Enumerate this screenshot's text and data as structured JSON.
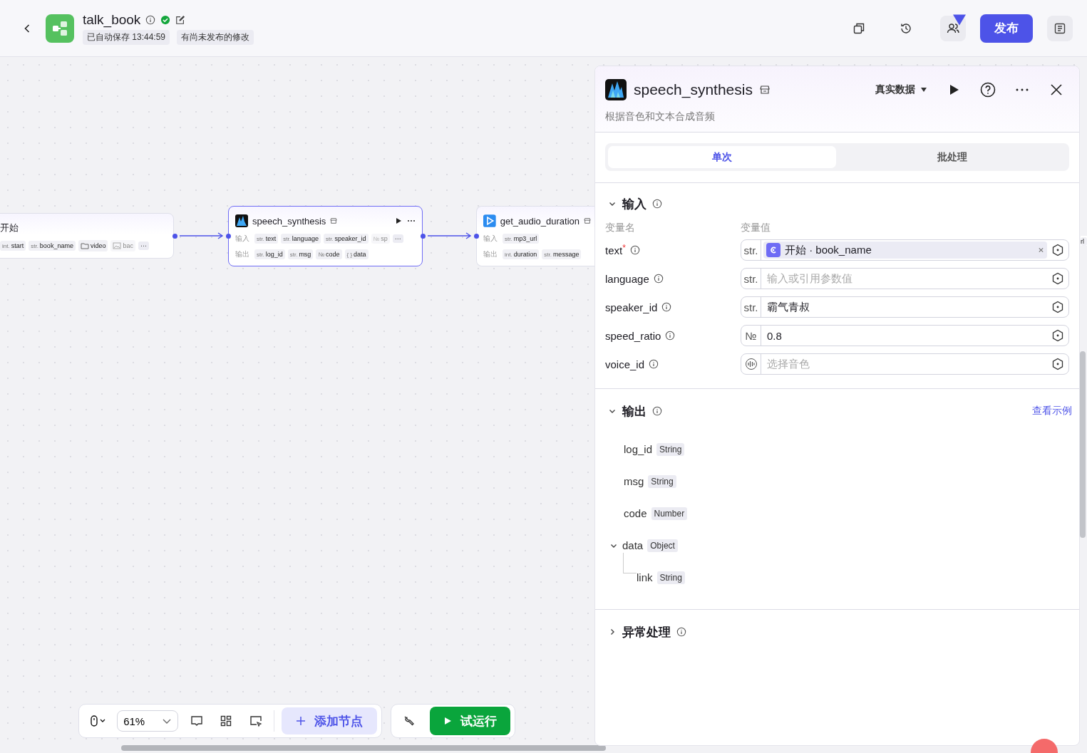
{
  "header": {
    "title": "talk_book",
    "verified": true,
    "autosave": "已自动保存 13:44:59",
    "unpublished": "有尚未发布的修改",
    "collaborators_badge": true,
    "publish": "发布"
  },
  "canvas": {
    "nodes": [
      {
        "kind": "start",
        "title": "开始",
        "selected": false,
        "rows": [
          {
            "tags": [
              {
                "kind": "typed",
                "type": "int.",
                "name": "start",
                "faded": false
              },
              {
                "kind": "typed",
                "type": "str.",
                "name": "book_name",
                "faded": false
              },
              {
                "kind": "folder",
                "name": "video",
                "faded": false
              },
              {
                "kind": "image",
                "name": "bac",
                "faded": true
              }
            ],
            "more": "⋯"
          }
        ]
      },
      {
        "kind": "plugin",
        "title": "speech_synthesis",
        "selected": true,
        "rows": [
          {
            "label": "输入",
            "tags": [
              {
                "kind": "typed",
                "type": "str.",
                "name": "text",
                "faded": false
              },
              {
                "kind": "typed",
                "type": "str.",
                "name": "language",
                "faded": false
              },
              {
                "kind": "typed",
                "type": "str.",
                "name": "speaker_id",
                "faded": false
              },
              {
                "kind": "typed",
                "type": "№",
                "name": "sp",
                "faded": true
              }
            ],
            "more": "⋯"
          },
          {
            "label": "输出",
            "tags": [
              {
                "kind": "typed",
                "type": "str.",
                "name": "log_id",
                "faded": false
              },
              {
                "kind": "typed",
                "type": "str.",
                "name": "msg",
                "faded": false
              },
              {
                "kind": "typed",
                "type": "№",
                "name": "code",
                "faded": false
              },
              {
                "kind": "typed",
                "type": "{ }",
                "name": "data",
                "faded": false
              }
            ]
          }
        ]
      },
      {
        "kind": "plugin",
        "title": "get_audio_duration",
        "selected": false,
        "rows": [
          {
            "label": "输入",
            "tags": [
              {
                "kind": "typed",
                "type": "str.",
                "name": "mp3_url",
                "faded": false
              }
            ]
          },
          {
            "label": "输出",
            "tags": [
              {
                "kind": "typed",
                "type": "int.",
                "name": "duration",
                "faded": false
              },
              {
                "kind": "typed",
                "type": "str.",
                "name": "message",
                "faded": false
              }
            ]
          }
        ]
      },
      {
        "kind": "fragment",
        "rows": [
          {
            "tags": [
              {
                "kind": "plain",
                "name": "rl",
                "faded": false
              }
            ]
          }
        ]
      }
    ],
    "zoom": "61%",
    "add_node": "添加节点",
    "test_run": "试运行"
  },
  "panel": {
    "title": "speech_synthesis",
    "description": "根据音色和文本合成音频",
    "data_mode": "真实数据",
    "tabs": [
      {
        "label": "单次",
        "selected": true
      },
      {
        "label": "批处理",
        "selected": false
      }
    ],
    "input_section": {
      "title": "输入",
      "expanded": true,
      "col_name": "变量名",
      "col_value": "变量值",
      "params": [
        {
          "name": "text",
          "required_mark": "*",
          "kind": "reference",
          "type": "str.",
          "value": "开始 · book_name"
        },
        {
          "name": "language",
          "kind": "text",
          "type": "str.",
          "placeholder": "输入或引用参数值"
        },
        {
          "name": "speaker_id",
          "kind": "text",
          "type": "str.",
          "value": "霸气青叔"
        },
        {
          "name": "speed_ratio",
          "kind": "text",
          "type": "№",
          "value": "0.8"
        },
        {
          "name": "voice_id",
          "kind": "voice",
          "placeholder": "选择音色"
        }
      ]
    },
    "output_section": {
      "title": "输出",
      "expanded": true,
      "link": "查看示例",
      "fields": [
        {
          "name": "log_id",
          "type": "String"
        },
        {
          "name": "msg",
          "type": "String"
        },
        {
          "name": "code",
          "type": "Number"
        },
        {
          "name": "data",
          "type": "Object",
          "expanded": true,
          "children": [
            {
              "name": "link",
              "type": "String"
            }
          ]
        }
      ]
    },
    "error_section": {
      "title": "异常处理",
      "expanded": false
    }
  }
}
